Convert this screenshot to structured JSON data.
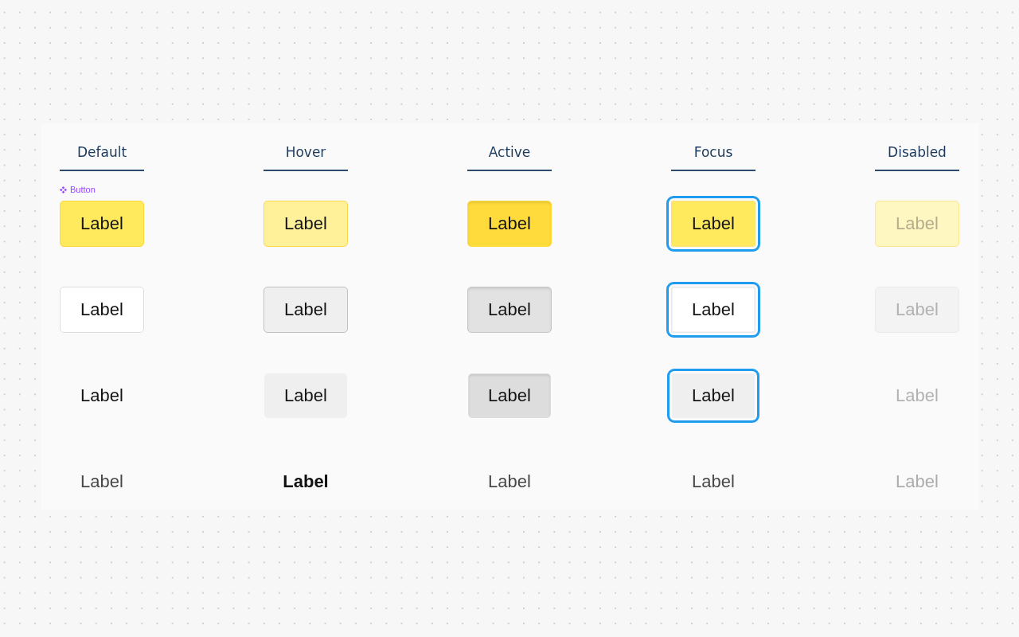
{
  "columns": [
    {
      "label": "Default"
    },
    {
      "label": "Hover"
    },
    {
      "label": "Active"
    },
    {
      "label": "Focus"
    },
    {
      "label": "Disabled"
    }
  ],
  "component_tag": "Button",
  "rows": [
    {
      "kind": "primary",
      "buttons": [
        {
          "label": "Label",
          "hovered": false,
          "pressed": false,
          "focused": false,
          "disabled": false
        },
        {
          "label": "Label",
          "hovered": true,
          "pressed": false,
          "focused": false,
          "disabled": false
        },
        {
          "label": "Label",
          "hovered": false,
          "pressed": true,
          "focused": false,
          "disabled": false
        },
        {
          "label": "Label",
          "hovered": false,
          "pressed": false,
          "focused": true,
          "disabled": false
        },
        {
          "label": "Label",
          "hovered": false,
          "pressed": false,
          "focused": false,
          "disabled": true
        }
      ]
    },
    {
      "kind": "secondary",
      "buttons": [
        {
          "label": "Label",
          "hovered": false,
          "pressed": false,
          "focused": false,
          "disabled": false
        },
        {
          "label": "Label",
          "hovered": true,
          "pressed": false,
          "focused": false,
          "disabled": false
        },
        {
          "label": "Label",
          "hovered": false,
          "pressed": true,
          "focused": false,
          "disabled": false
        },
        {
          "label": "Label",
          "hovered": false,
          "pressed": false,
          "focused": true,
          "disabled": false
        },
        {
          "label": "Label",
          "hovered": false,
          "pressed": false,
          "focused": false,
          "disabled": true
        }
      ]
    },
    {
      "kind": "ghost",
      "buttons": [
        {
          "label": "Label",
          "hovered": false,
          "pressed": false,
          "focused": false,
          "disabled": false
        },
        {
          "label": "Label",
          "hovered": true,
          "pressed": false,
          "focused": false,
          "disabled": false
        },
        {
          "label": "Label",
          "hovered": false,
          "pressed": true,
          "focused": false,
          "disabled": false
        },
        {
          "label": "Label",
          "hovered": false,
          "pressed": false,
          "focused": true,
          "disabled": false
        },
        {
          "label": "Label",
          "hovered": false,
          "pressed": false,
          "focused": false,
          "disabled": true
        }
      ]
    },
    {
      "kind": "link",
      "buttons": [
        {
          "label": "Label",
          "hovered": false,
          "disabled": false
        },
        {
          "label": "Label",
          "hovered": true,
          "disabled": false
        },
        {
          "label": "Label",
          "hovered": false,
          "disabled": false
        },
        {
          "label": "Label",
          "hovered": false,
          "disabled": false
        },
        {
          "label": "Label",
          "hovered": false,
          "disabled": true
        }
      ]
    }
  ]
}
